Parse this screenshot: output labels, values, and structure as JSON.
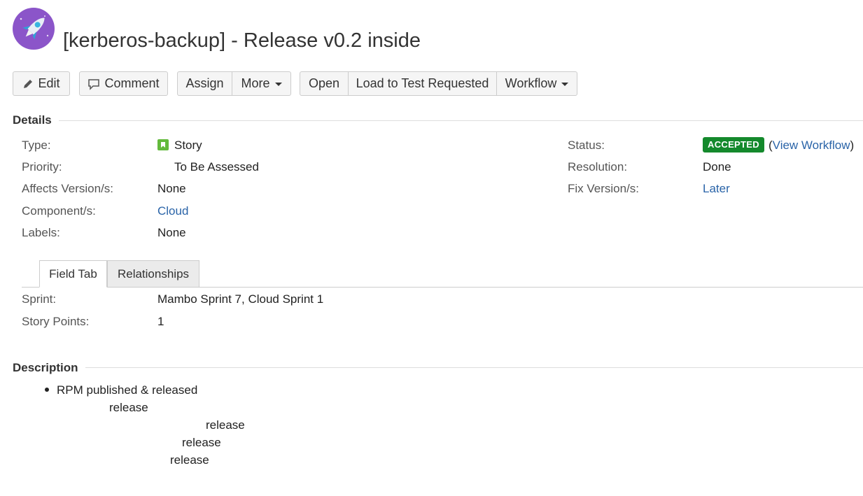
{
  "issue": {
    "title": "[kerberos-backup] - Release v0.2 inside"
  },
  "toolbar": {
    "edit": "Edit",
    "comment": "Comment",
    "assign": "Assign",
    "more": "More",
    "open": "Open",
    "load_to_test": "Load to Test Requested",
    "workflow": "Workflow"
  },
  "details": {
    "heading": "Details",
    "type_label": "Type:",
    "type_value": "Story",
    "priority_label": "Priority:",
    "priority_value": "To Be Assessed",
    "affects_label": "Affects Version/s:",
    "affects_value": "None",
    "component_label": "Component/s:",
    "component_value": "Cloud",
    "labels_label": "Labels:",
    "labels_value": "None",
    "status_label": "Status:",
    "status_value": "ACCEPTED",
    "status_open_paren": "(",
    "view_workflow": "View Workflow",
    "status_close_paren": ")",
    "resolution_label": "Resolution:",
    "resolution_value": "Done",
    "fix_label": "Fix Version/s:",
    "fix_value": "Later"
  },
  "tabs": [
    {
      "label": "Field Tab",
      "active": true
    },
    {
      "label": "Relationships",
      "active": false
    }
  ],
  "fields": {
    "sprint_label": "Sprint:",
    "sprint_value": "Mambo Sprint 7, Cloud Sprint 1",
    "points_label": "Story Points:",
    "points_value": "1"
  },
  "description": {
    "heading": "Description",
    "lines": [
      "RPM published & released",
      "release",
      "release",
      "release",
      "release"
    ]
  },
  "colors": {
    "accent_link": "#2a64a8",
    "status_green": "#14892c",
    "avatar_purple": "#8b55c9",
    "story_green": "#63ba3c"
  },
  "icons": [
    "rocket-icon",
    "pencil-icon",
    "comment-icon",
    "chevron-down-icon",
    "story-icon"
  ]
}
